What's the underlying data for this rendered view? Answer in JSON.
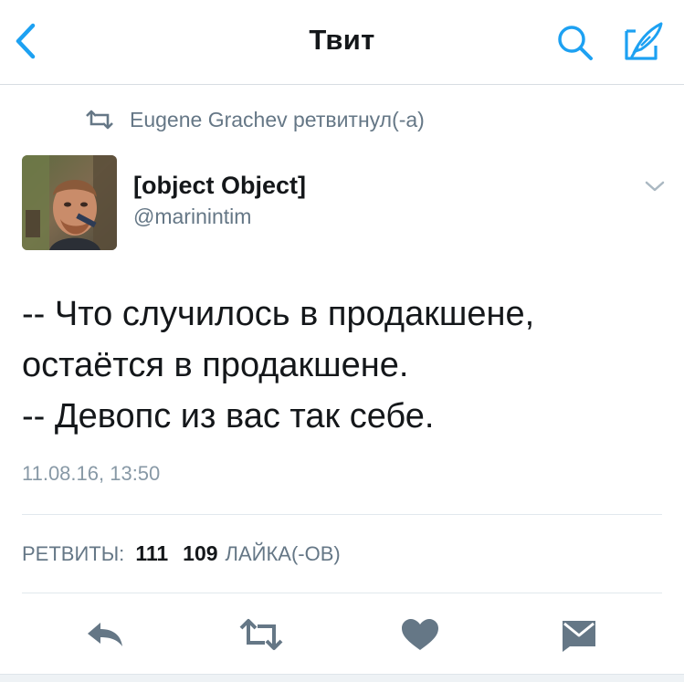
{
  "nav": {
    "title": "Твит",
    "back_icon": "chevron-left-icon",
    "search_icon": "search-icon",
    "compose_icon": "compose-icon"
  },
  "retweet_context": {
    "text": "Eugene Grachev ретвитнул(-а)",
    "icon": "retweet-icon"
  },
  "author": {
    "name": "[object Object]",
    "handle": "@marinintim"
  },
  "tweet": {
    "lines": [
      "-- Что случилось в продакшене,",
      "остаётся в продакшене.",
      "-- Девопс из вас так себе."
    ],
    "timestamp": "11.08.16, 13:50"
  },
  "stats": {
    "retweets_label": "РЕТВИТЫ:",
    "retweets_count": "111",
    "likes_count": "109",
    "likes_label": "ЛАЙКА(-ОВ)"
  },
  "actions": {
    "reply_icon": "reply-icon",
    "retweet_icon": "retweet-icon",
    "like_icon": "heart-icon",
    "dm_icon": "direct-message-icon"
  },
  "colors": {
    "accent": "#1da1f2",
    "muted": "#657786",
    "icon_gray": "#657786",
    "text": "#14171a"
  }
}
